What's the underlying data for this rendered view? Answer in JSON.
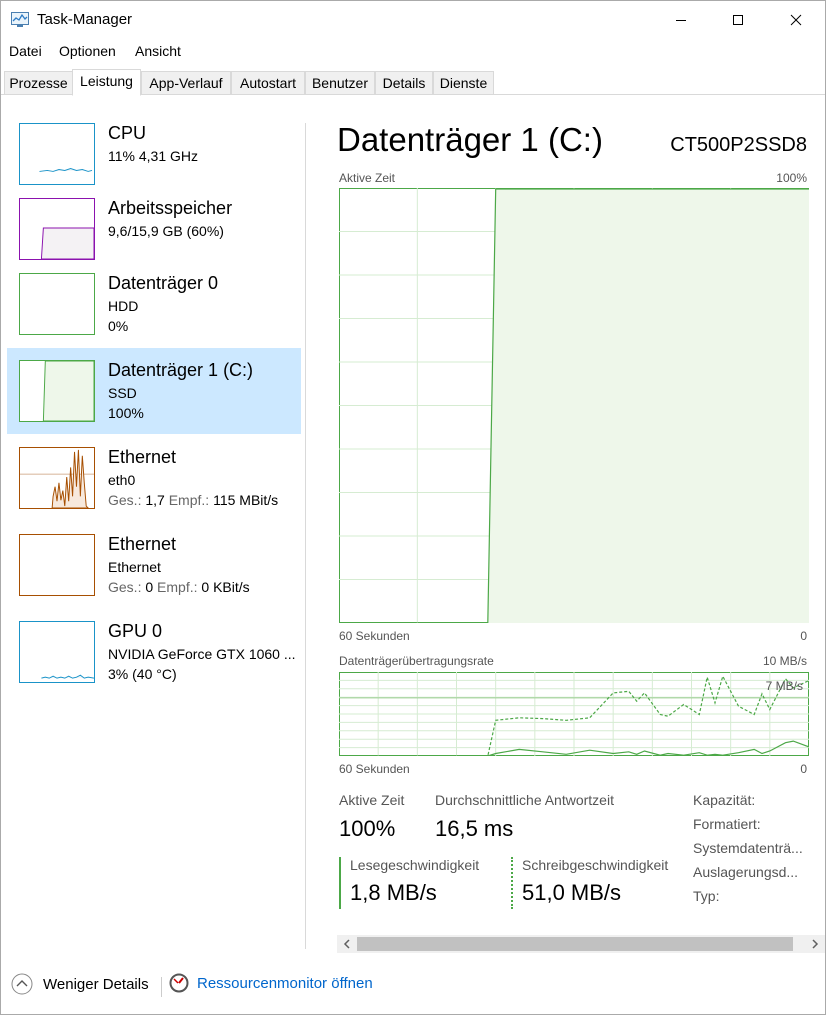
{
  "window": {
    "title": "Task-Manager"
  },
  "menu": [
    "Datei",
    "Optionen",
    "Ansicht"
  ],
  "tabs": [
    {
      "label": "Prozesse"
    },
    {
      "label": "Leistung",
      "active": true
    },
    {
      "label": "App-Verlauf"
    },
    {
      "label": "Autostart"
    },
    {
      "label": "Benutzer"
    },
    {
      "label": "Details"
    },
    {
      "label": "Dienste"
    }
  ],
  "sidebar": {
    "items": [
      {
        "title": "CPU",
        "line1": "11%  4,31 GHz",
        "line2": "",
        "color": "#1a93c8",
        "selected": false
      },
      {
        "title": "Arbeitsspeicher",
        "line1": "9,6/15,9 GB (60%)",
        "line2": "",
        "color": "#8b12ae",
        "selected": false
      },
      {
        "title": "Datenträger 0",
        "line1": "HDD",
        "line2": "0%",
        "color": "#4ca847",
        "selected": false
      },
      {
        "title": "Datenträger 1 (C:)",
        "line1": "SSD",
        "line2": "100%",
        "color": "#4ca847",
        "selected": true
      },
      {
        "title": "Ethernet",
        "line1": "eth0",
        "send_label": "Ges.:",
        "send_value": "1,7",
        "recv_label": "Empf.:",
        "recv_value": "115 MBit/s",
        "color": "#a74f01",
        "selected": false
      },
      {
        "title": "Ethernet",
        "line1": "Ethernet",
        "send_label": "Ges.:",
        "send_value": "0",
        "recv_label": "Empf.:",
        "recv_value": "0 KBit/s",
        "color": "#a74f01",
        "selected": false
      },
      {
        "title": "GPU 0",
        "line1": "NVIDIA GeForce GTX 1060 ...",
        "line2": "3%  (40 °C)",
        "color": "#1a93c8",
        "selected": false
      }
    ]
  },
  "main": {
    "title": "Datenträger 1 (C:)",
    "model": "CT500P2SSD8",
    "graph1": {
      "label": "Aktive Zeit",
      "max_label": "100%",
      "x_left": "60 Sekunden",
      "x_right": "0"
    },
    "graph2": {
      "label": "Datenträgerübertragungsrate",
      "max_label": "10 MB/s",
      "line_label": "7 MB/s",
      "x_left": "60 Sekunden",
      "x_right": "0"
    },
    "stats": {
      "active_time_label": "Aktive Zeit",
      "active_time_value": "100%",
      "response_label": "Durchschnittliche Antwortzeit",
      "response_value": "16,5 ms",
      "read_label": "Lesegeschwindigkeit",
      "read_value": "1,8 MB/s",
      "write_label": "Schreibgeschwindigkeit",
      "write_value": "51,0 MB/s"
    },
    "properties": [
      "Kapazität:",
      "Formatiert:",
      "Systemdatenträ...",
      "Auslagerungsd...",
      "Typ:"
    ]
  },
  "footer": {
    "less_details": "Weniger Details",
    "resource_monitor": "Ressourcenmonitor öffnen"
  },
  "colors": {
    "disk": "#4ca847",
    "disk_fill": "#eef7ea",
    "selected_bg": "#cce8ff",
    "link": "#0066cc"
  },
  "chart_data": [
    {
      "type": "area",
      "title": "Aktive Zeit",
      "xlabel": "60 Sekunden",
      "ylim": [
        0,
        100
      ],
      "x": [
        60,
        41,
        40,
        0
      ],
      "series": [
        {
          "values": [
            0,
            0,
            100,
            100
          ]
        }
      ]
    },
    {
      "type": "line",
      "title": "Datenträgerübertragungsrate",
      "xlabel": "60 Sekunden",
      "ylim": [
        0,
        10
      ],
      "x": [
        60,
        41,
        40,
        37,
        34,
        31,
        28,
        25,
        23,
        22,
        21,
        19,
        18,
        16,
        14,
        13,
        12,
        11,
        9,
        7,
        6,
        5,
        3,
        2,
        0
      ],
      "series": [
        {
          "name": "Schreibgeschwindigkeit",
          "values": [
            0,
            0,
            4.3,
            4.6,
            4.5,
            4.3,
            4.6,
            7.6,
            7.8,
            6.6,
            7.6,
            5.0,
            4.8,
            6.2,
            5.0,
            9.5,
            6.4,
            9.6,
            6.0,
            5.0,
            7.5,
            5.6,
            9.3,
            8.2,
            9.1
          ]
        },
        {
          "name": "Lesegeschwindigkeit",
          "values": [
            0,
            0,
            0.3,
            0.8,
            0.5,
            0.2,
            0.7,
            0.3,
            0.5,
            0.2,
            0.6,
            0.1,
            0.3,
            0.1,
            0.4,
            0.1,
            0.2,
            0.1,
            0.4,
            0.8,
            0.3,
            0.6,
            1.6,
            1.8,
            1.1
          ]
        }
      ]
    }
  ]
}
